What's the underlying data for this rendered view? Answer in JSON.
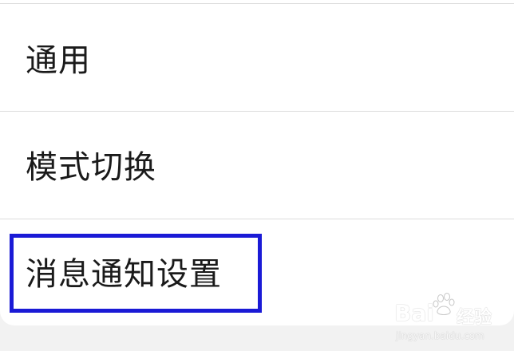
{
  "settings": {
    "items": [
      {
        "label": "通用"
      },
      {
        "label": "模式切换"
      },
      {
        "label": "消息通知设置"
      }
    ]
  },
  "watermark": {
    "brand": "Bai",
    "brand_cn": "经验",
    "url": "jingyan.baidu.com"
  },
  "colors": {
    "highlight": "#1a1ad6",
    "card": "#ffffff",
    "background": "#f2f2f2",
    "divider": "#dcdcdc"
  }
}
